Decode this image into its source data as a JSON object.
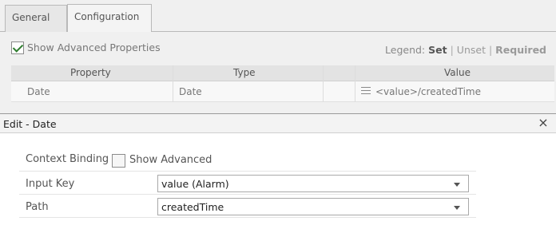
{
  "tabs": [
    {
      "label": "General",
      "active": false
    },
    {
      "label": "Configuration",
      "active": true
    }
  ],
  "options": {
    "show_advanced_label": "Show Advanced Properties",
    "show_advanced_checked": true
  },
  "legend": {
    "prefix": "Legend:",
    "set": "Set",
    "sep": "|",
    "unset": "Unset",
    "required": "Required"
  },
  "grid": {
    "headers": [
      "Property",
      "Type",
      "Value"
    ],
    "rows": [
      {
        "property": "Date",
        "type": "Date",
        "value": "<value>/createdTime"
      }
    ]
  },
  "dialog": {
    "title": "Edit - Date",
    "close_glyph": "×",
    "context_binding_label": "Context Binding",
    "show_advanced_label": "Show Advanced",
    "show_advanced_checked": false,
    "input_key_label": "Input Key",
    "input_key_value": "value (Alarm)",
    "path_label": "Path",
    "path_value": "createdTime"
  },
  "colors": {
    "check": "#2f7d2f",
    "background": "#f0f0f0",
    "dialog_bg": "#ffffff"
  }
}
